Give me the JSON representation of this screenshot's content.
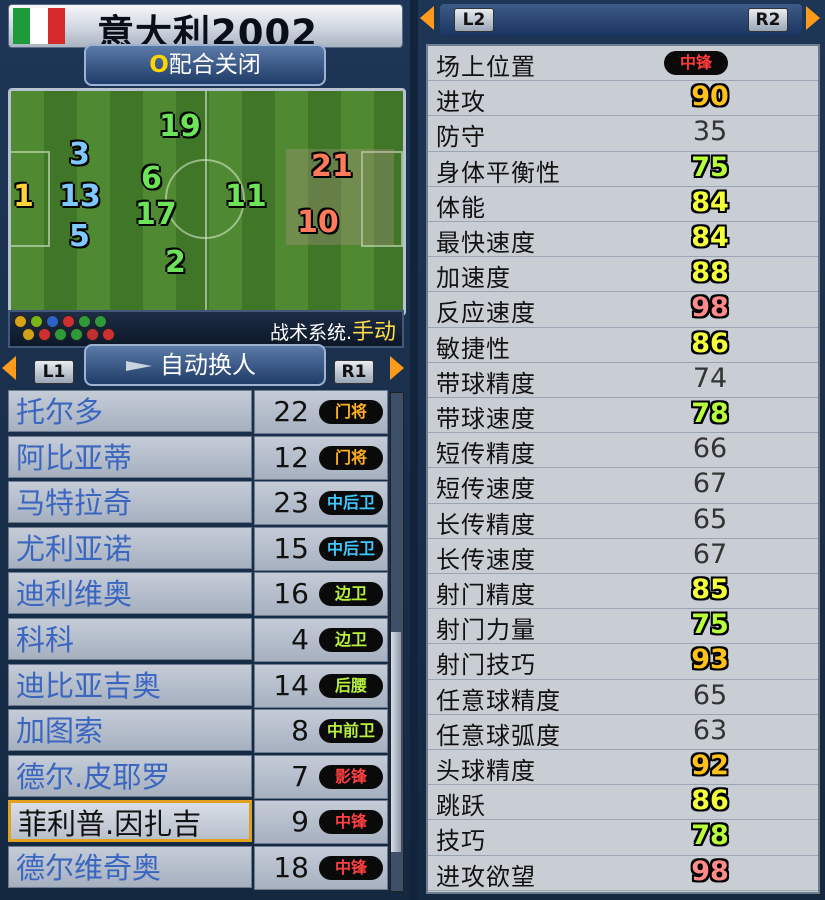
{
  "team": {
    "name": "意大利2002",
    "flag_colors": [
      "#1d9a3a",
      "#ffffff",
      "#d42a2a"
    ]
  },
  "teamwork": {
    "key": "O",
    "label": "配合关闭"
  },
  "pitch": {
    "players": [
      {
        "num": "19",
        "color": "#6de35a"
      },
      {
        "num": "3",
        "color": "#7ec7ff"
      },
      {
        "num": "6",
        "color": "#6de35a"
      },
      {
        "num": "1",
        "color": "#ffd23a"
      },
      {
        "num": "13",
        "color": "#7ec7ff"
      },
      {
        "num": "17",
        "color": "#6de35a"
      },
      {
        "num": "11",
        "color": "#6de35a"
      },
      {
        "num": "5",
        "color": "#7ec7ff"
      },
      {
        "num": "2",
        "color": "#6de35a"
      },
      {
        "num": "21",
        "color": "#ff7a5a"
      },
      {
        "num": "10",
        "color": "#ff7a5a"
      }
    ],
    "tactic_prefix": "战术系统.",
    "tactic_value": "手动",
    "strategy_dot_colors": [
      "#d8a318",
      "#7ab51a",
      "#2a64c8",
      "#d03030",
      "#2e9a3a",
      "#2e9a3a",
      "#cfa21a",
      "#d03030",
      "#2e9a3a",
      "#2e9a3a",
      "#c03030",
      "#d03030"
    ]
  },
  "switch": {
    "left_key": "L1",
    "label": "自动换人",
    "right_key": "R1"
  },
  "roster": [
    {
      "name": "托尔多",
      "number": "22",
      "pos": "门将",
      "pos_color": "#ffb020"
    },
    {
      "name": "阿比亚蒂",
      "number": "12",
      "pos": "门将",
      "pos_color": "#ffb020"
    },
    {
      "name": "马特拉奇",
      "number": "23",
      "pos": "中后卫",
      "pos_color": "#40c8ff"
    },
    {
      "name": "尤利亚诺",
      "number": "15",
      "pos": "中后卫",
      "pos_color": "#40c8ff"
    },
    {
      "name": "迪利维奥",
      "number": "16",
      "pos": "边卫",
      "pos_color": "#b8f040"
    },
    {
      "name": "科科",
      "number": "4",
      "pos": "边卫",
      "pos_color": "#b8f040"
    },
    {
      "name": "迪比亚吉奥",
      "number": "14",
      "pos": "后腰",
      "pos_color": "#b8f040"
    },
    {
      "name": "加图索",
      "number": "8",
      "pos": "中前卫",
      "pos_color": "#b8f040"
    },
    {
      "name": "德尔.皮耶罗",
      "number": "7",
      "pos": "影锋",
      "pos_color": "#ff4040"
    },
    {
      "name": "菲利普.因扎吉",
      "number": "9",
      "pos": "中锋",
      "pos_color": "#ff4040",
      "selected": true
    },
    {
      "name": "德尔维奇奥",
      "number": "18",
      "pos": "中锋",
      "pos_color": "#ff4040"
    }
  ],
  "stats_header": {
    "left_key": "L2",
    "right_key": "R2"
  },
  "stats": [
    {
      "label": "场上位置",
      "value": "中锋",
      "badge": true
    },
    {
      "label": "进攻",
      "value": "90",
      "color": "#ffc21a"
    },
    {
      "label": "防守",
      "value": "35",
      "color": ""
    },
    {
      "label": "身体平衡性",
      "value": "75",
      "color": "#b6ff3a"
    },
    {
      "label": "体能",
      "value": "84",
      "color": "#f3ff3a"
    },
    {
      "label": "最快速度",
      "value": "84",
      "color": "#f3ff3a"
    },
    {
      "label": "加速度",
      "value": "88",
      "color": "#f3ff3a"
    },
    {
      "label": "反应速度",
      "value": "98",
      "color": "#ff8a8a"
    },
    {
      "label": "敏捷性",
      "value": "86",
      "color": "#f3ff3a"
    },
    {
      "label": "带球精度",
      "value": "74",
      "color": ""
    },
    {
      "label": "带球速度",
      "value": "78",
      "color": "#b6ff3a"
    },
    {
      "label": "短传精度",
      "value": "66",
      "color": ""
    },
    {
      "label": "短传速度",
      "value": "67",
      "color": ""
    },
    {
      "label": "长传精度",
      "value": "65",
      "color": ""
    },
    {
      "label": "长传速度",
      "value": "67",
      "color": ""
    },
    {
      "label": "射门精度",
      "value": "85",
      "color": "#f3ff3a"
    },
    {
      "label": "射门力量",
      "value": "75",
      "color": "#b6ff3a"
    },
    {
      "label": "射门技巧",
      "value": "93",
      "color": "#ffc21a"
    },
    {
      "label": "任意球精度",
      "value": "65",
      "color": ""
    },
    {
      "label": "任意球弧度",
      "value": "63",
      "color": ""
    },
    {
      "label": "头球精度",
      "value": "92",
      "color": "#ffc21a"
    },
    {
      "label": "跳跃",
      "value": "86",
      "color": "#f3ff3a"
    },
    {
      "label": "技巧",
      "value": "78",
      "color": "#b6ff3a"
    },
    {
      "label": "进攻欲望",
      "value": "98",
      "color": "#ff8a8a"
    }
  ]
}
